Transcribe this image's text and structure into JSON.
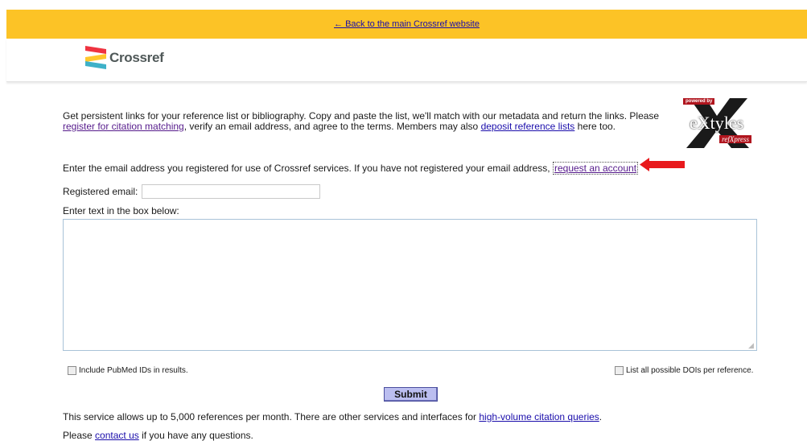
{
  "topbar": {
    "back_link": "← Back to the main Crossref website"
  },
  "header": {
    "logo_text": "Crossref"
  },
  "intro": {
    "text_1": "Get persistent links for your reference list or bibliography. Copy and paste the list, we'll match with our metadata and return the links. Please",
    "link_register": "register for citation matching",
    "text_2": ", verify an email address, and agree to the terms. Members may also",
    "link_deposit": "deposit reference lists",
    "text_3": " here too."
  },
  "badge": {
    "powered_by": "powered by",
    "extyles": "eXtyles",
    "refxpress": "refXpress"
  },
  "email_note": {
    "text": "Enter the email address you registered for use of Crossref services. If you have not registered your email address,",
    "link_request": "request an account"
  },
  "form": {
    "registered_email_label": "Registered email:",
    "registered_email_value": "",
    "text_box_label": "Enter text in the box below:",
    "text_box_value": "",
    "include_pubmed_label": "Include PubMed IDs in results.",
    "list_dois_label": "List all possible DOIs per reference.",
    "submit_label": "Submit"
  },
  "footer": {
    "limit_text": "This service allows up to 5,000 references per month. There are other services and interfaces for",
    "link_high_volume": "high-volume citation queries",
    "limit_end": ".",
    "contact_pre": "Please",
    "link_contact": "contact us",
    "contact_post": " if you have any questions."
  },
  "colors": {
    "topbar": "#fcc326",
    "arrow": "#e8191c",
    "submit_bg": "#bbbef0"
  }
}
